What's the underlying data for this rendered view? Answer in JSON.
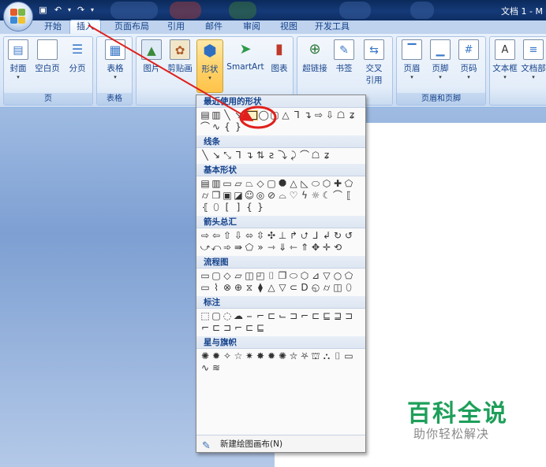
{
  "window": {
    "doc_title": "文档 1 - M"
  },
  "quick_access": {
    "save_icon": "save-icon",
    "undo_icon": "undo-icon",
    "redo_icon": "redo-icon"
  },
  "tabs": [
    {
      "label": "开始"
    },
    {
      "label": "插入",
      "active": true
    },
    {
      "label": "页面布局"
    },
    {
      "label": "引用"
    },
    {
      "label": "邮件"
    },
    {
      "label": "审阅"
    },
    {
      "label": "视图"
    },
    {
      "label": "开发工具"
    }
  ],
  "ribbon": {
    "groups": {
      "page": "页",
      "table": "表格",
      "header_footer": "页眉和页脚"
    },
    "buttons": {
      "cover": "封面",
      "blank_page": "空白页",
      "page_break": "分页",
      "table": "表格",
      "picture": "图片",
      "clipart": "剪贴画",
      "shapes": "形状",
      "smartart": "SmartArt",
      "chart": "图表",
      "hyperlink": "超链接",
      "bookmark": "书签",
      "cross_ref_1": "交叉",
      "cross_ref_2": "引用",
      "header": "页眉",
      "footer": "页脚",
      "page_number": "页码",
      "textbox": "文本框",
      "quickparts": "文档部"
    }
  },
  "shapes_menu": {
    "sections": {
      "recent": "最近使用的形状",
      "lines": "线条",
      "basic": "基本形状",
      "arrows": "箭头总汇",
      "flowchart": "流程图",
      "callouts": "标注",
      "stars": "星与旗帜"
    },
    "footer_label": "新建绘图画布(N)"
  },
  "watermark": {
    "title": "百科全说",
    "subtitle": "助你轻松解决"
  },
  "colors": {
    "highlight_circle": "#e0201c",
    "accent_green": "#1e9f5a",
    "ribbon_blue": "#15428b"
  }
}
